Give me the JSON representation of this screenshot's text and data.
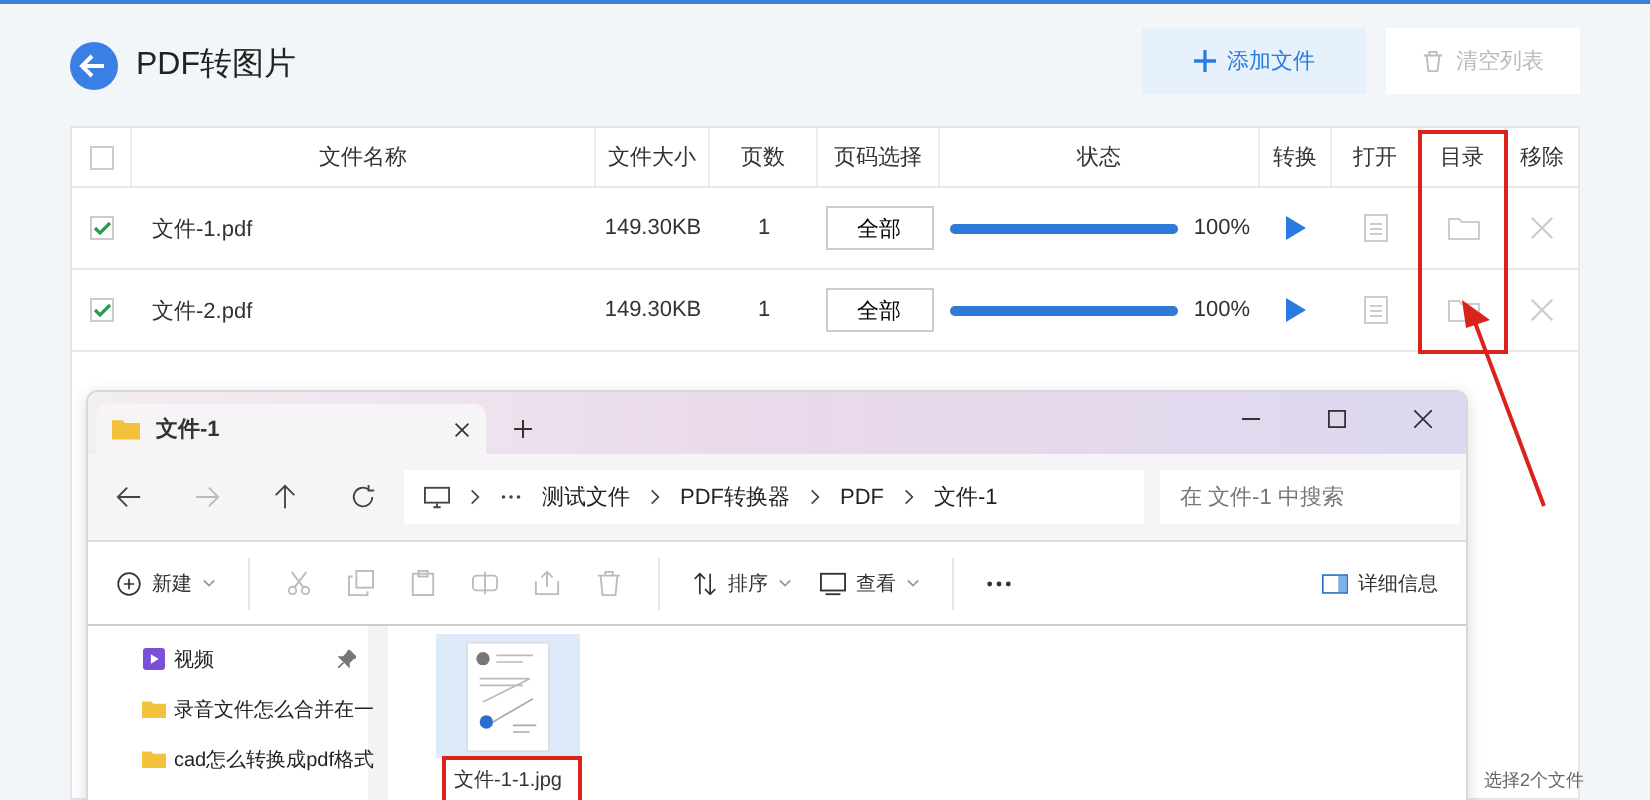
{
  "header": {
    "title": "PDF转图片",
    "add_button": "添加文件",
    "clear_button": {
      "label": "清空列表",
      "disabled": true
    }
  },
  "table": {
    "columns": [
      "文件名称",
      "文件大小",
      "页数",
      "页码选择",
      "状态",
      "转换",
      "打开",
      "目录",
      "移除"
    ],
    "header_checked": false,
    "rows": [
      {
        "checked": true,
        "name": "文件-1.pdf",
        "size": "149.30KB",
        "pages": "1",
        "page_select": "全部",
        "level": 1,
        "reading": "100%"
      },
      {
        "checked": true,
        "name": "文件-2.pdf",
        "size": "149.30KB",
        "pages": "1",
        "page_select": "全部",
        "level": 1,
        "reading": "100%"
      }
    ]
  },
  "status_text": "选择2个文件",
  "explorer": {
    "tab": "文件-1",
    "breadcrumb": [
      "测试文件",
      "PDF转换器",
      "PDF",
      "文件-1"
    ],
    "search": {
      "placeholder": "在 文件-1 中搜索"
    },
    "toolbar": {
      "new": "新建",
      "sort": "排序",
      "view": "查看",
      "details": "详细信息"
    },
    "sidebar": [
      {
        "kind": "video",
        "label": "视频",
        "pinned": true
      },
      {
        "kind": "folder",
        "label": "录音文件怎么合并在一",
        "pinned": false
      },
      {
        "kind": "folder",
        "label": "cad怎么转换成pdf格式",
        "pinned": false
      }
    ],
    "files": [
      {
        "name": "文件-1-1.jpg",
        "selected": true
      }
    ]
  }
}
